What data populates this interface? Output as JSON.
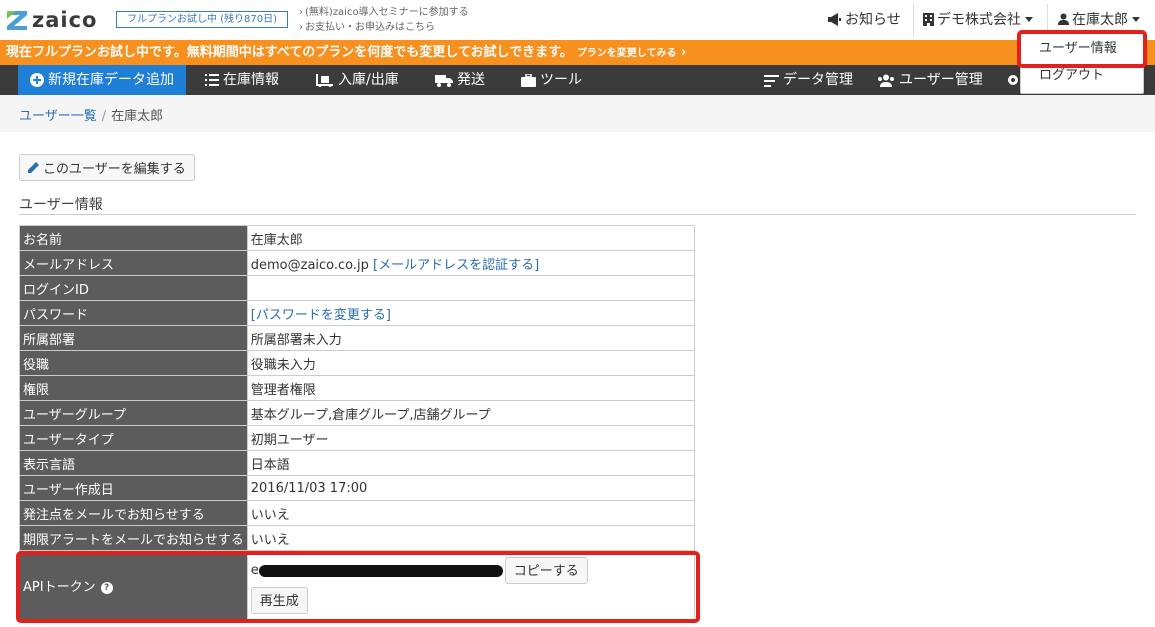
{
  "header": {
    "logo_text": "zaico",
    "trial_badge": "フルプランお試し中 (残り870日)",
    "links": [
      "(無料)zaico導入セミナーに参加する",
      "お支払い・お申込みはこちら"
    ],
    "notices": "お知らせ",
    "company": "デモ株式会社",
    "user": "在庫太郎"
  },
  "banner": {
    "text": "現在フルプランお試し中です。無料期間中はすべてのプランを何度でも変更してお試しできます。",
    "change_link": "プランを変更してみる"
  },
  "nav": {
    "add": "新規在庫データ追加",
    "inventory": "在庫情報",
    "inout": "入庫/出庫",
    "shipping": "発送",
    "tools": "ツール",
    "data_mgmt": "データ管理",
    "user_mgmt": "ユーザー管理"
  },
  "dropdown": {
    "user_info": "ユーザー情報",
    "logout": "ログアウト"
  },
  "breadcrumb": {
    "parent": "ユーザー一覧",
    "separator": "/",
    "current": "在庫太郎"
  },
  "edit_button": "このユーザーを編集する",
  "section_title": "ユーザー情報",
  "table": {
    "rows": [
      {
        "label": "お名前",
        "value": "在庫太郎"
      },
      {
        "label": "メールアドレス",
        "value": "demo@zaico.co.jp",
        "link": "[メールアドレスを認証する]"
      },
      {
        "label": "ログインID",
        "value": ""
      },
      {
        "label": "パスワード",
        "link": "[パスワードを変更する]"
      },
      {
        "label": "所属部署",
        "value": "所属部署未入力"
      },
      {
        "label": "役職",
        "value": "役職未入力"
      },
      {
        "label": "権限",
        "value": "管理者権限"
      },
      {
        "label": "ユーザーグループ",
        "value": "基本グループ,倉庫グループ,店舗グループ"
      },
      {
        "label": "ユーザータイプ",
        "value": "初期ユーザー"
      },
      {
        "label": "表示言語",
        "value": "日本語"
      },
      {
        "label": "ユーザー作成日",
        "value": "2016/11/03 17:00"
      },
      {
        "label": "発注点をメールでお知らせする",
        "value": "いいえ"
      },
      {
        "label": "期限アラートをメールでお知らせする",
        "value": "いいえ"
      }
    ],
    "api": {
      "label": "APIトークン",
      "help": "?",
      "token_prefix": "e",
      "copy_button": "コピーする",
      "regen_button": "再生成"
    }
  },
  "colors": {
    "banner": "#f7901e",
    "nav": "#3b3b3b",
    "nav_active": "#1f7ed6",
    "highlight": "#e3201b",
    "link": "#2a6db0"
  }
}
